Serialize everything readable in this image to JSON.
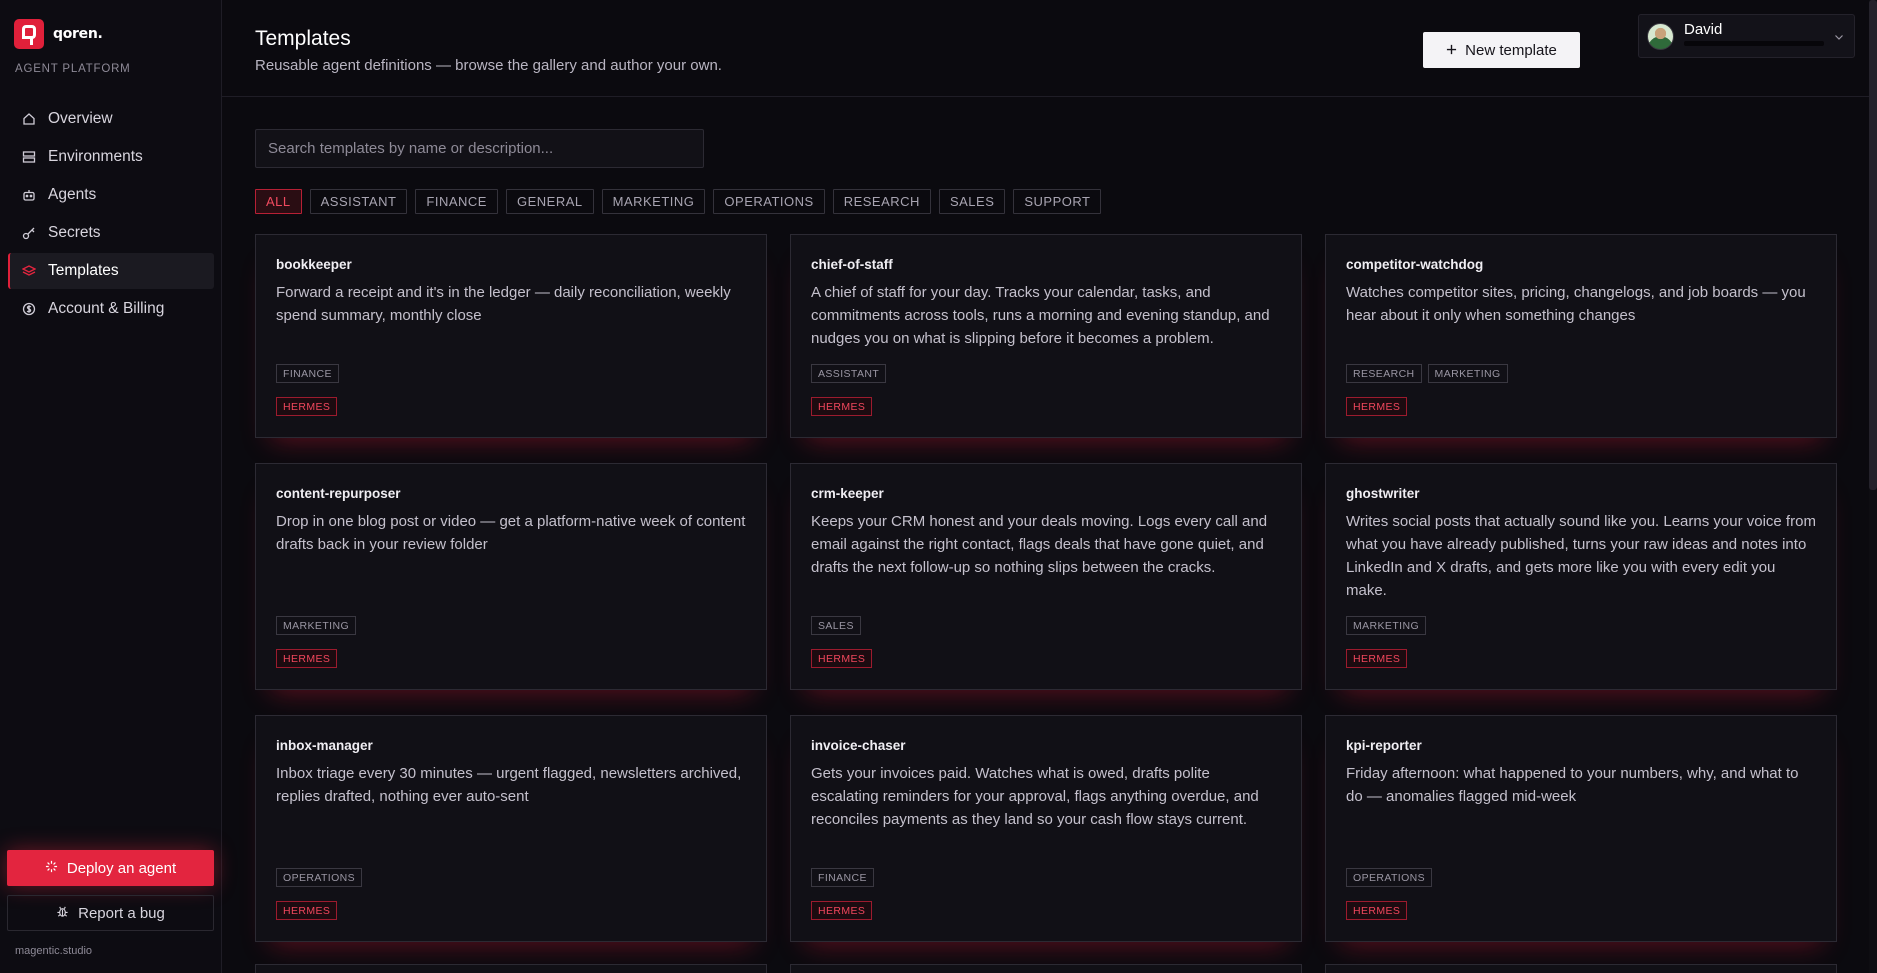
{
  "brand": {
    "name": "qoren.",
    "platform_label": "AGENT PLATFORM"
  },
  "nav": [
    {
      "label": "Overview",
      "icon": "home-icon",
      "active": false
    },
    {
      "label": "Environments",
      "icon": "server-icon",
      "active": false
    },
    {
      "label": "Agents",
      "icon": "bot-icon",
      "active": false
    },
    {
      "label": "Secrets",
      "icon": "key-icon",
      "active": false
    },
    {
      "label": "Templates",
      "icon": "layers-icon",
      "active": true
    },
    {
      "label": "Account & Billing",
      "icon": "dollar-icon",
      "active": false
    }
  ],
  "sidebar_actions": {
    "deploy_label": "Deploy an agent",
    "bug_label": "Report a bug"
  },
  "footer": "magentic.studio",
  "header": {
    "title": "Templates",
    "subtitle": "Reusable agent definitions — browse the gallery and author your own.",
    "new_template_label": "New template"
  },
  "user": {
    "name": "David"
  },
  "search": {
    "placeholder": "Search templates by name or description..."
  },
  "filters": [
    "ALL",
    "ASSISTANT",
    "FINANCE",
    "GENERAL",
    "MARKETING",
    "OPERATIONS",
    "RESEARCH",
    "SALES",
    "SUPPORT"
  ],
  "active_filter": "ALL",
  "colors": {
    "accent": "#e3253f",
    "background": "#0b0a0f",
    "card": "#111016"
  },
  "templates": [
    {
      "name": "bookkeeper",
      "description": "Forward a receipt and it's in the ledger — daily reconciliation, weekly spend summary, monthly close",
      "tags": [
        "FINANCE"
      ],
      "engine": "HERMES"
    },
    {
      "name": "chief-of-staff",
      "description": "A chief of staff for your day. Tracks your calendar, tasks, and commitments across tools, runs a morning and evening standup, and nudges you on what is slipping before it becomes a problem.",
      "tags": [
        "ASSISTANT"
      ],
      "engine": "HERMES"
    },
    {
      "name": "competitor-watchdog",
      "description": "Watches competitor sites, pricing, changelogs, and job boards — you hear about it only when something changes",
      "tags": [
        "RESEARCH",
        "MARKETING"
      ],
      "engine": "HERMES"
    },
    {
      "name": "content-repurposer",
      "description": "Drop in one blog post or video — get a platform-native week of content drafts back in your review folder",
      "tags": [
        "MARKETING"
      ],
      "engine": "HERMES"
    },
    {
      "name": "crm-keeper",
      "description": "Keeps your CRM honest and your deals moving. Logs every call and email against the right contact, flags deals that have gone quiet, and drafts the next follow-up so nothing slips between the cracks.",
      "tags": [
        "SALES"
      ],
      "engine": "HERMES"
    },
    {
      "name": "ghostwriter",
      "description": "Writes social posts that actually sound like you. Learns your voice from what you have already published, turns your raw ideas and notes into LinkedIn and X drafts, and gets more like you with every edit you make.",
      "tags": [
        "MARKETING"
      ],
      "engine": "HERMES"
    },
    {
      "name": "inbox-manager",
      "description": "Inbox triage every 30 minutes — urgent flagged, newsletters archived, replies drafted, nothing ever auto-sent",
      "tags": [
        "OPERATIONS"
      ],
      "engine": "HERMES"
    },
    {
      "name": "invoice-chaser",
      "description": "Gets your invoices paid. Watches what is owed, drafts polite escalating reminders for your approval, flags anything overdue, and reconciles payments as they land so your cash flow stays current.",
      "tags": [
        "FINANCE"
      ],
      "engine": "HERMES"
    },
    {
      "name": "kpi-reporter",
      "description": "Friday afternoon: what happened to your numbers, why, and what to do — anomalies flagged mid-week",
      "tags": [
        "OPERATIONS"
      ],
      "engine": "HERMES"
    }
  ]
}
